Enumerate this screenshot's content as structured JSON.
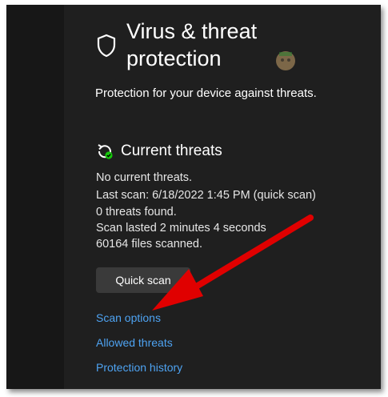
{
  "header": {
    "title": "Virus & threat protection",
    "subtitle": "Protection for your device against threats.",
    "icon": "shield-icon"
  },
  "current_threats": {
    "title": "Current threats",
    "icon": "threat-scan-icon",
    "lines": [
      "No current threats.",
      "Last scan: 6/18/2022 1:45 PM (quick scan)",
      "0 threats found.",
      "Scan lasted 2 minutes 4 seconds",
      "60164 files scanned."
    ],
    "quick_scan_label": "Quick scan"
  },
  "links": {
    "scan_options": "Scan options",
    "allowed_threats": "Allowed threats",
    "protection_history": "Protection history"
  },
  "colors": {
    "background": "#1f1f1f",
    "sidebar": "#171717",
    "link": "#4ea3f2",
    "annotation_arrow": "#e00000",
    "status_ok": "#16c60c"
  }
}
